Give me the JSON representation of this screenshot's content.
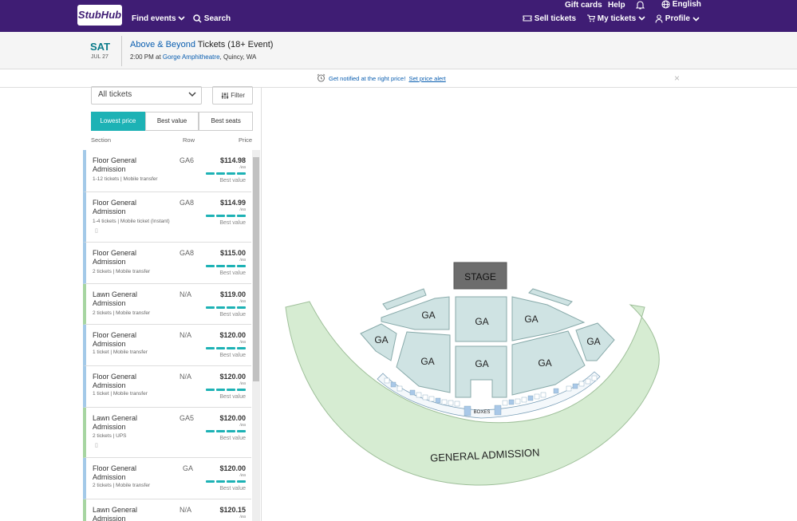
{
  "nav": {
    "logo": "StubHub",
    "find_events": "Find events",
    "search": "Search",
    "gift_cards": "Gift cards",
    "help": "Help",
    "language": "English",
    "sell_tickets": "Sell tickets",
    "my_tickets": "My tickets",
    "profile": "Profile"
  },
  "event": {
    "day": "SAT",
    "date": "JUL 27",
    "artist": "Above & Beyond",
    "title_rest": " Tickets (18+ Event)",
    "time": "2:00 PM at ",
    "venue": "Gorge Amphitheatre",
    "location": ", Quincy, WA"
  },
  "alert": {
    "text": "Get notified at the right price!",
    "link": "Set price alert",
    "close": "×"
  },
  "filters": {
    "select_value": "All tickets",
    "filter_label": "Filter",
    "tabs": [
      {
        "label": "Lowest price",
        "active": true
      },
      {
        "label": "Best value",
        "active": false
      },
      {
        "label": "Best seats",
        "active": false
      }
    ]
  },
  "columns": {
    "section": "Section",
    "row": "Row",
    "price": "Price"
  },
  "listings": [
    {
      "section": "Floor General Admission",
      "row": "GA6",
      "price": "$114.98",
      "ea": "/ea",
      "meta": "1-12 tickets | Mobile transfer",
      "badge": "Best value",
      "type": "floor",
      "doc": false
    },
    {
      "section": "Floor General Admission",
      "row": "GA8",
      "price": "$114.99",
      "ea": "/ea",
      "meta": "1-4 tickets | Mobile ticket (Instant)",
      "badge": "Best value",
      "type": "floor",
      "doc": true
    },
    {
      "section": "Floor General Admission",
      "row": "GA8",
      "price": "$115.00",
      "ea": "/ea",
      "meta": "2 tickets | Mobile transfer",
      "badge": "Best value",
      "type": "floor",
      "doc": false
    },
    {
      "section": "Lawn General Admission",
      "row": "N/A",
      "price": "$119.00",
      "ea": "/ea",
      "meta": "2 tickets | Mobile transfer",
      "badge": "Best value",
      "type": "lawn",
      "doc": false
    },
    {
      "section": "Floor General Admission",
      "row": "N/A",
      "price": "$120.00",
      "ea": "/ea",
      "meta": "1 ticket | Mobile transfer",
      "badge": "Best value",
      "type": "floor",
      "doc": false
    },
    {
      "section": "Floor General Admission",
      "row": "N/A",
      "price": "$120.00",
      "ea": "/ea",
      "meta": "1 ticket | Mobile transfer",
      "badge": "Best value",
      "type": "floor",
      "doc": false
    },
    {
      "section": "Lawn General Admission",
      "row": "GA5",
      "price": "$120.00",
      "ea": "/ea",
      "meta": "2 tickets | UPS",
      "badge": "Best value",
      "type": "lawn",
      "doc": true
    },
    {
      "section": "Floor General Admission",
      "row": "GA",
      "price": "$120.00",
      "ea": "/ea",
      "meta": "2 tickets | Mobile transfer",
      "badge": "Best value",
      "type": "floor",
      "doc": false
    },
    {
      "section": "Lawn General Admission",
      "row": "N/A",
      "price": "$120.15",
      "ea": "/ea",
      "meta": "",
      "badge": "",
      "type": "lawn",
      "doc": false
    }
  ],
  "map": {
    "stage": "STAGE",
    "ga": "GA",
    "boxes": "BOXES",
    "general_admission": "GENERAL ADMISSION",
    "colors": {
      "ga_fill": "#cfe3e3",
      "lawn_fill": "#d6ecd2",
      "stage_fill": "#6d6d6d",
      "accent": "#1db2b5",
      "nav": "#3f1d74"
    }
  }
}
